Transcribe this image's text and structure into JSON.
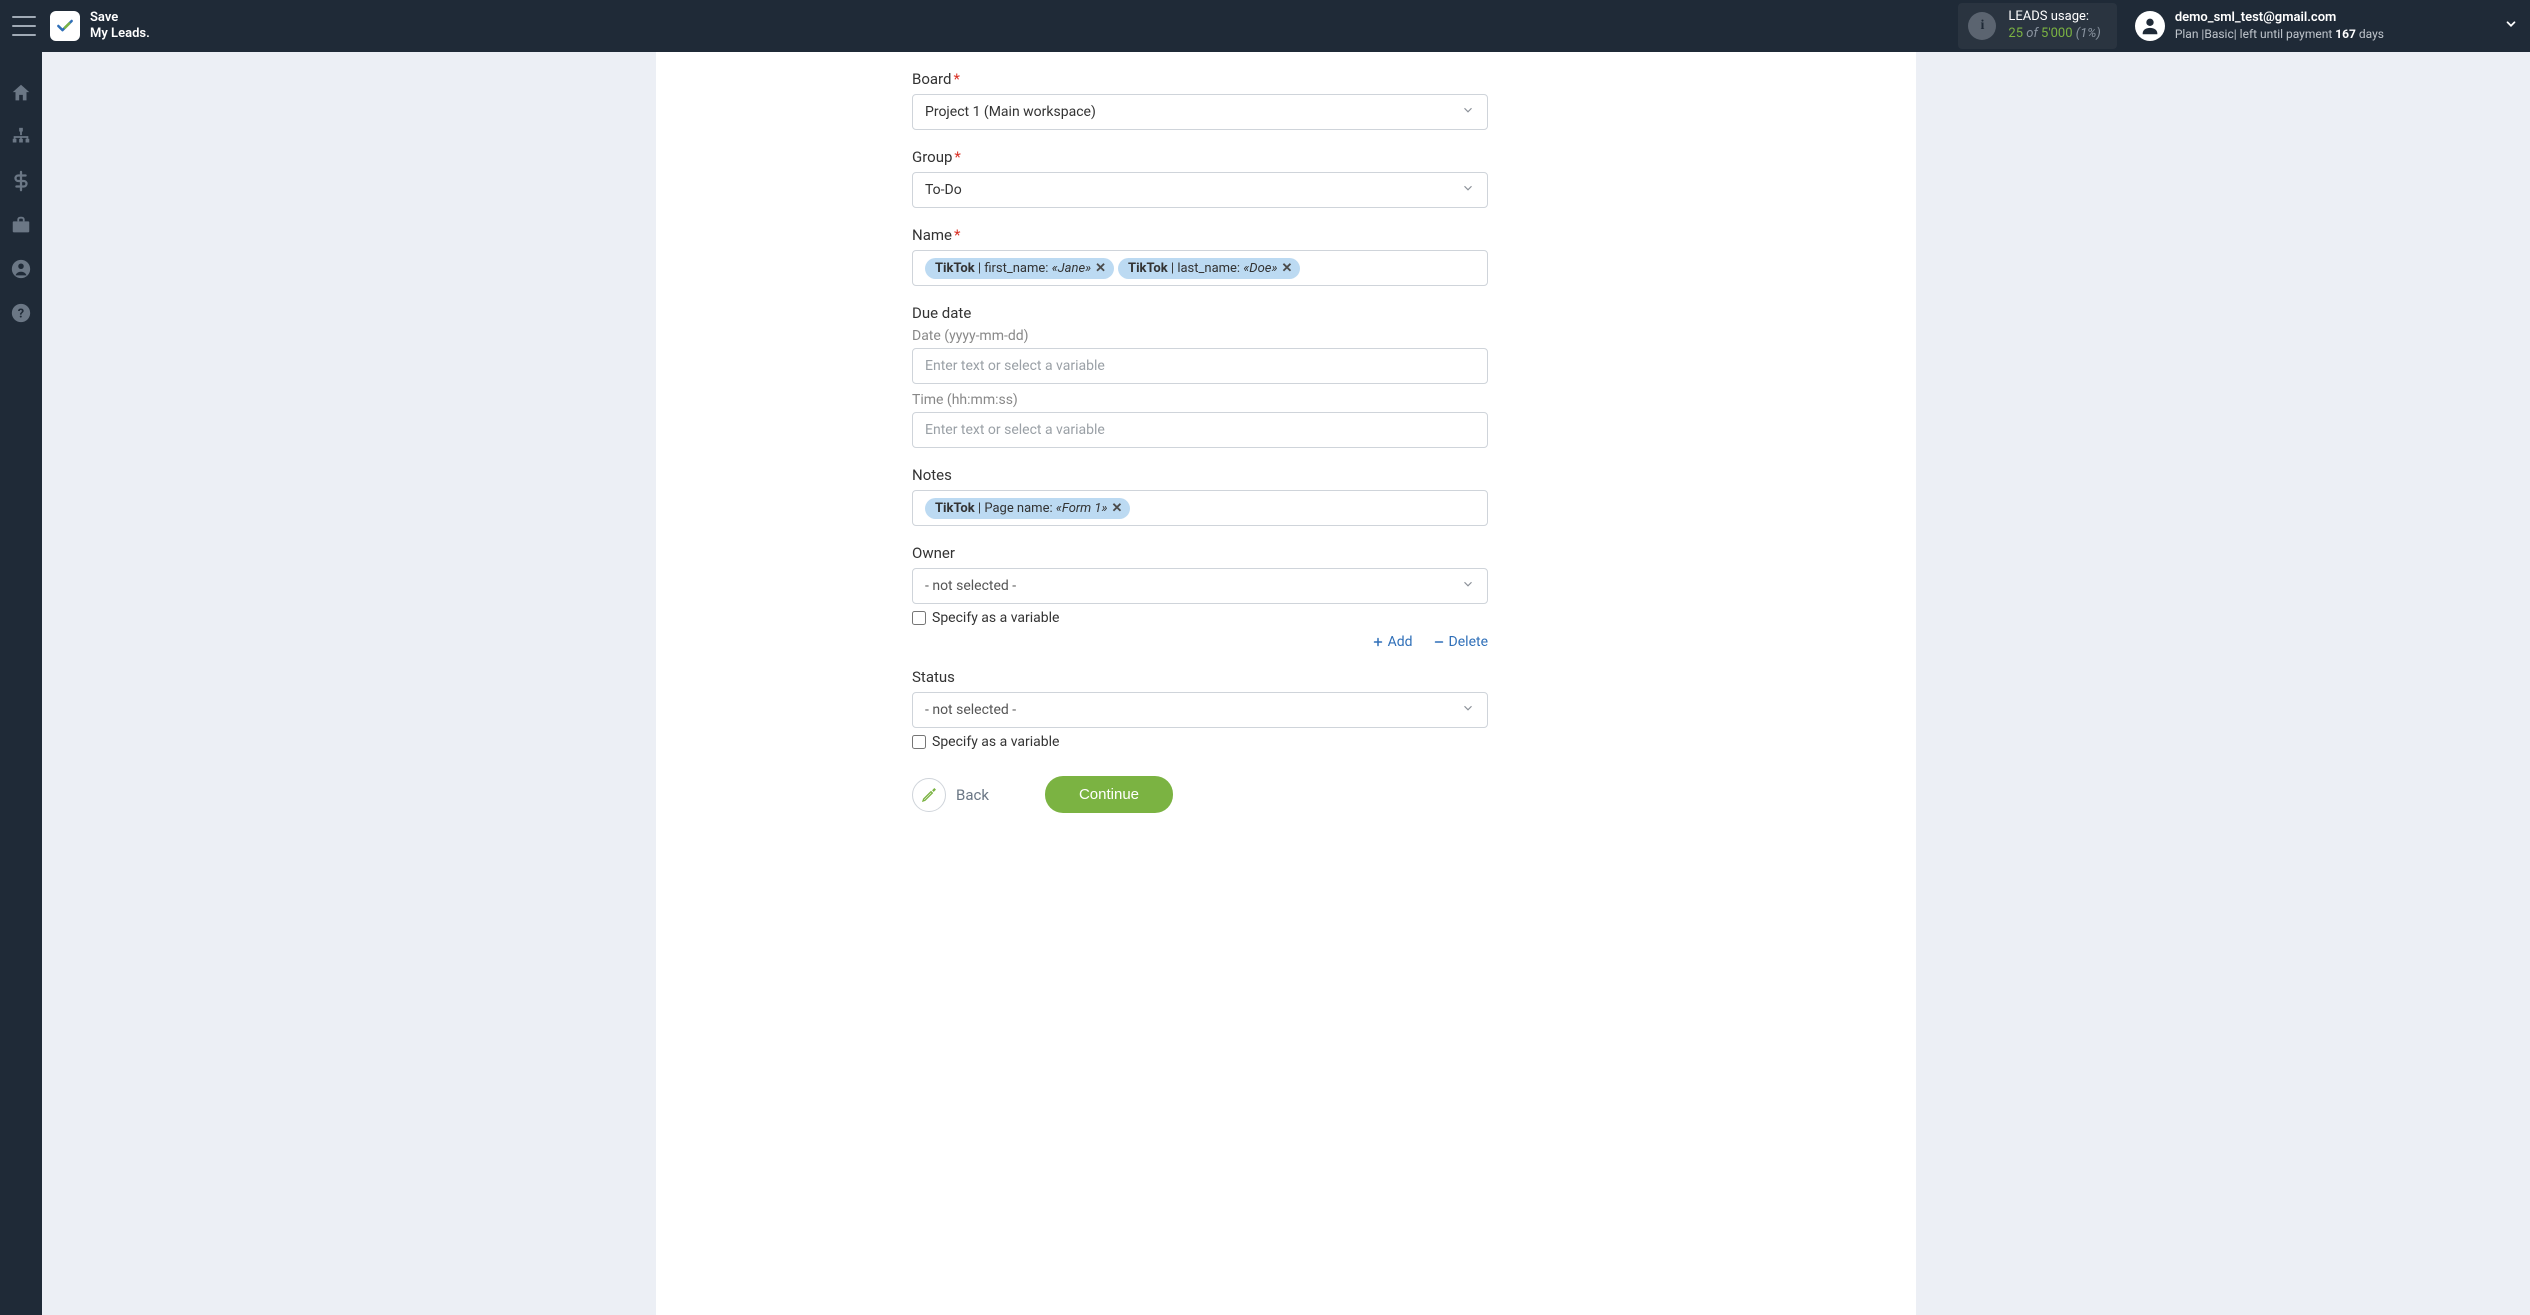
{
  "brand": {
    "line1": "Save",
    "line2": "My Leads."
  },
  "leads": {
    "label": "LEADS usage:",
    "used": "25",
    "of": "of",
    "total": "5'000",
    "pct": "(1%)"
  },
  "user": {
    "email": "demo_sml_test@gmail.com",
    "plan_prefix": "Plan |Basic| left until payment ",
    "days_num": "167",
    "days_suffix": " days"
  },
  "form": {
    "board": {
      "label": "Board",
      "value": "Project 1 (Main workspace)"
    },
    "group": {
      "label": "Group",
      "value": "To-Do"
    },
    "name": {
      "label": "Name",
      "chip1_src": "TikTok",
      "chip1_field": "first_name:",
      "chip1_val": "«Jane»",
      "chip2_src": "TikTok",
      "chip2_field": "last_name:",
      "chip2_val": "«Doe»"
    },
    "due": {
      "label": "Due date",
      "date_sub": "Date (yyyy-mm-dd)",
      "date_placeholder": "Enter text or select a variable",
      "time_sub": "Time (hh:mm:ss)",
      "time_placeholder": "Enter text or select a variable"
    },
    "notes": {
      "label": "Notes",
      "chip_src": "TikTok",
      "chip_field": "Page name:",
      "chip_val": "«Form 1»"
    },
    "owner": {
      "label": "Owner",
      "value": "- not selected -",
      "checkbox": "Specify as a variable",
      "add": "Add",
      "delete": "Delete"
    },
    "status": {
      "label": "Status",
      "value": "- not selected -",
      "checkbox": "Specify as a variable"
    },
    "back": "Back",
    "continue": "Continue"
  }
}
